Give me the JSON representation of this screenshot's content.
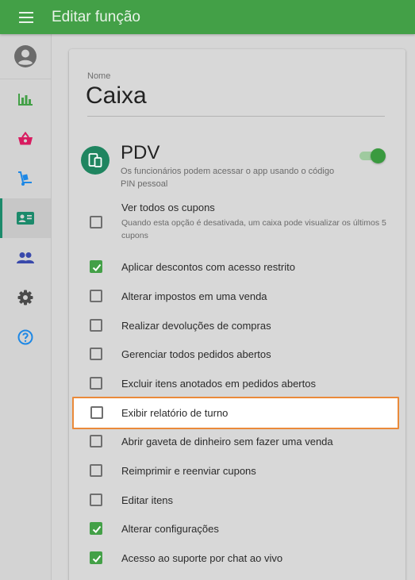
{
  "topbar": {
    "title": "Editar função",
    "menu_icon": "hamburger-icon"
  },
  "sidebar": {
    "avatar_icon": "account-circle-icon",
    "items": [
      {
        "icon": "bar-chart-icon",
        "color": "#43a047",
        "active": false
      },
      {
        "icon": "basket-icon",
        "color": "#d81b60",
        "active": false
      },
      {
        "icon": "dolly-icon",
        "color": "#1e88e5",
        "active": false
      },
      {
        "icon": "badge-icon",
        "color": "#1b8a6b",
        "active": true
      },
      {
        "icon": "people-icon",
        "color": "#3949ab",
        "active": false
      },
      {
        "icon": "gear-icon",
        "color": "#4a4a4a",
        "active": false
      },
      {
        "icon": "help-icon",
        "color": "#1e88e5",
        "active": false
      }
    ]
  },
  "form": {
    "name_label": "Nome",
    "name_value": "Caixa"
  },
  "pdv": {
    "title": "PDV",
    "description": "Os funcionários podem acessar o app usando o código PIN pessoal",
    "enabled": true
  },
  "permissions": [
    {
      "label": "Ver todos os cupons",
      "sub": "Quando esta opção é desativada, um caixa pode visualizar os últimos 5 cupons",
      "checked": false
    },
    {
      "label": "Aplicar descontos com acesso restrito",
      "checked": true
    },
    {
      "label": "Alterar impostos em uma venda",
      "checked": false
    },
    {
      "label": "Realizar devoluções de compras",
      "checked": false
    },
    {
      "label": "Gerenciar todos pedidos abertos",
      "checked": false
    },
    {
      "label": "Excluir itens anotados em pedidos abertos",
      "checked": false
    },
    {
      "label": "Exibir relatório de turno",
      "checked": false,
      "highlighted": true
    },
    {
      "label": "Abrir gaveta de dinheiro sem fazer uma venda",
      "checked": false
    },
    {
      "label": "Reimprimir e reenviar cupons",
      "checked": false
    },
    {
      "label": "Editar itens",
      "checked": false
    },
    {
      "label": "Alterar configurações",
      "checked": true
    },
    {
      "label": "Acesso ao suporte por chat ao vivo",
      "checked": true
    }
  ],
  "colors": {
    "primary": "#43a047",
    "highlight_border": "#ea8a3a",
    "pdv_icon_bg": "#1f8560"
  }
}
